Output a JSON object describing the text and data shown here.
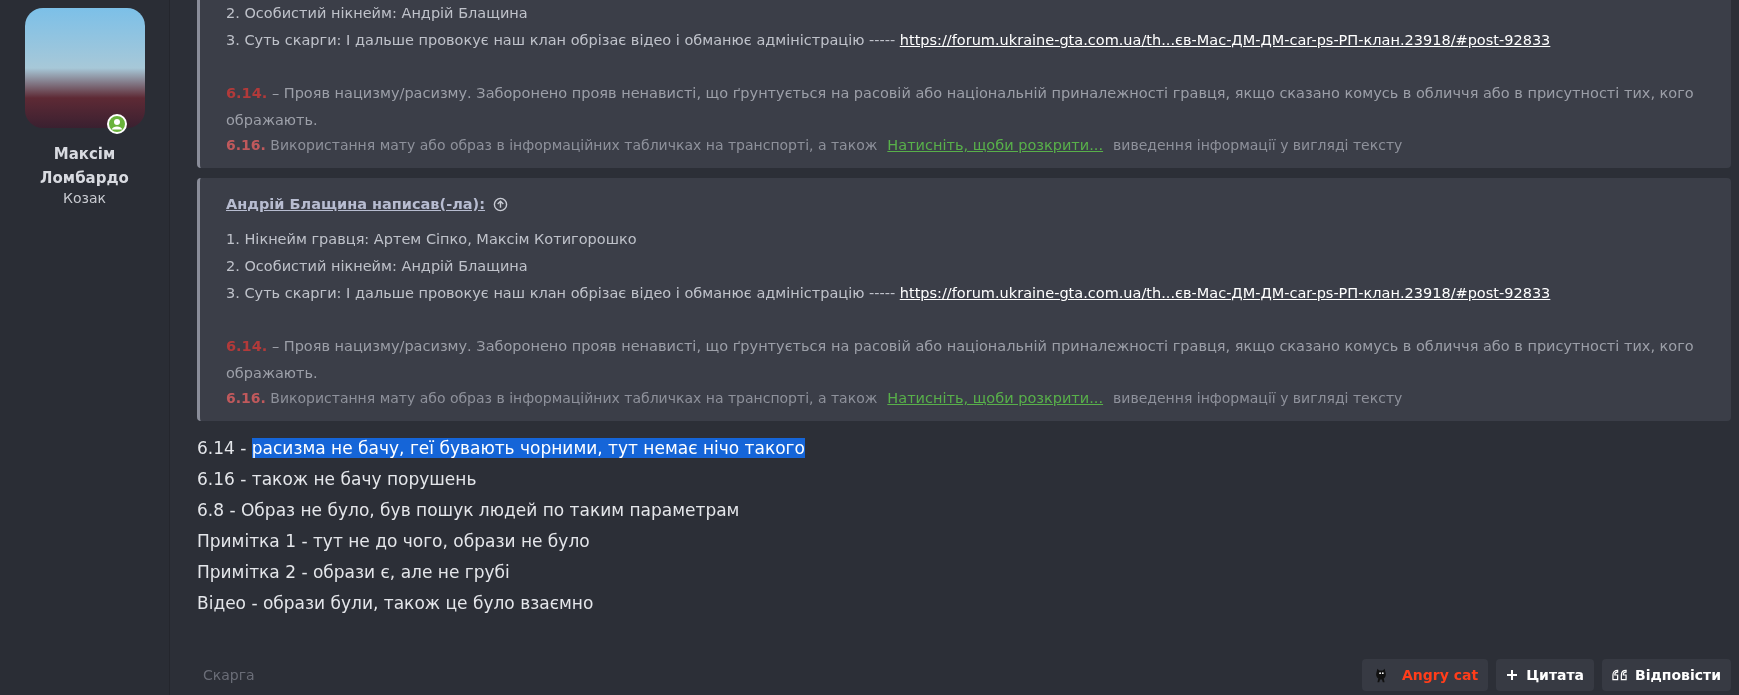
{
  "author": {
    "name": "Максім Ломбардо",
    "title": "Козак",
    "online": true
  },
  "quotes": [
    {
      "lines": [
        {
          "text": "2. Особистий нікнейм: Андрій Блащина"
        },
        {
          "text": "3. Суть скарги: І дальше провокує наш клан обрізає відео і обманює адміністрацію ----- ",
          "link": "https://forum.ukraine-gta.com.ua/th...єв-Мас-ДМ-ДМ-car-ps-РП-клан.23918/#post-92833"
        }
      ],
      "rule": {
        "number": "6.14.",
        "text": "– Прояв нацизму/расизму. Заборонено прояв ненависті, що ґрунтується на расовій або національній приналежності гравця, якщо сказано комусь в обличчя або в присутності тих, кого ображають."
      },
      "faded": {
        "number": "6.16.",
        "left": "Використання мату або образ в інформаційних табличках на транспорті, а також",
        "right": "виведення інформації у вигляді тексту"
      },
      "expand": "Натисніть, щоби розкрити..."
    },
    {
      "attribution": "Андрій Блащина написав(-ла):",
      "lines": [
        {
          "text": "1. Нікнейм гравця: Артем Сіпко, Максім Котигорошко"
        },
        {
          "text": "2. Особистий нікнейм: Андрій Блащина"
        },
        {
          "text": "3. Суть скарги: І дальше провокує наш клан обрізає відео і обманює адміністрацію ----- ",
          "link": "https://forum.ukraine-gta.com.ua/th...єв-Мас-ДМ-ДМ-car-ps-РП-клан.23918/#post-92833"
        }
      ],
      "rule": {
        "number": "6.14.",
        "text": "– Прояв нацизму/расизму. Заборонено прояв ненависті, що ґрунтується на расовій або національній приналежності гравця, якщо сказано комусь в обличчя або в присутності тих, кого ображають."
      },
      "faded": {
        "number": "6.16.",
        "left": "Використання мату або образ в інформаційних табличках на транспорті, а також",
        "right": "виведення інформації у вигляді тексту"
      },
      "expand": "Натисніть, щоби розкрити..."
    }
  ],
  "message": [
    {
      "text": "6.14 - ",
      "selection": "расизма не бачу, геї бувають чорними, тут немає нічо такого"
    },
    {
      "text": "6.16 - також не бачу порушень"
    },
    {
      "text": "6.8 - Образ не було, був пошук людей по таким параметрам"
    },
    {
      "text": "Примітка 1 - тут не до чого, образи не було"
    },
    {
      "text": "Примітка 2 - образи є, але не грубі"
    },
    {
      "text": "Відео - образи були, також це було взаємно"
    }
  ],
  "tag": "Скарга",
  "actions": [
    {
      "kind": "reaction",
      "label": "Angry cat"
    },
    {
      "kind": "quote",
      "label": "Цитата"
    },
    {
      "kind": "reply",
      "label": "Відповісти"
    }
  ]
}
